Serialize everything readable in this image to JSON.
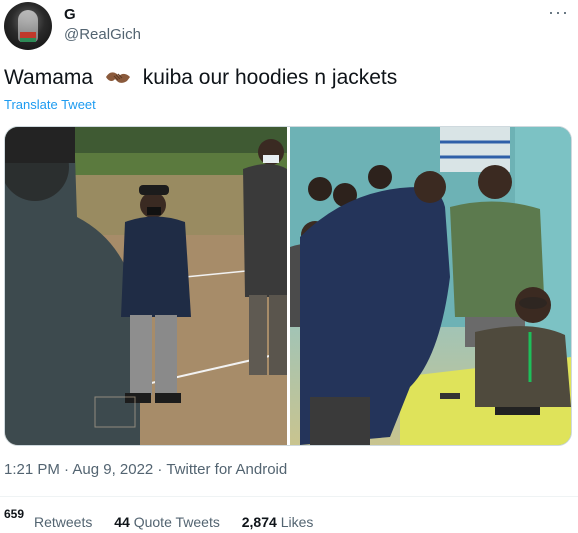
{
  "author": {
    "name": "G",
    "handle": "@RealGich",
    "avatar_icon": "avatar-image"
  },
  "menu_icon": "more-options-icon",
  "tweet": {
    "text_before": "Wamama",
    "emoji": "handshake-emoji",
    "text_after": "kuiba our hoodies n jackets",
    "translate_label": "Translate Tweet"
  },
  "media": {
    "photo_left_icon": "photo-image",
    "photo_right_icon": "photo-image"
  },
  "meta": {
    "timestamp": "1:21 PM · Aug 9, 2022 · Twitter for Android"
  },
  "stats": {
    "retweets_count": "659",
    "retweets_label": "Retweets",
    "quote_count": "44",
    "quote_label": "Quote Tweets",
    "likes_count": "2,874",
    "likes_label": "Likes"
  },
  "colors": {
    "link": "#1d9bf0",
    "secondary_text": "#536471",
    "primary_text": "#0f1419"
  }
}
